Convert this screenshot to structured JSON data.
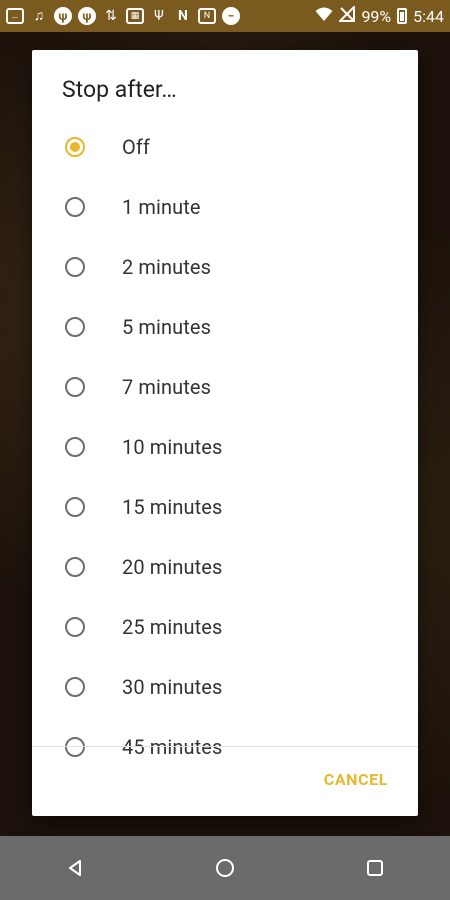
{
  "status_bar": {
    "battery": "99%",
    "time": "5:44",
    "icons": [
      "message-icon",
      "music-icon",
      "tuning-fork-icon",
      "tuning-fork-icon",
      "transfer-icon",
      "photo-icon",
      "usb-icon",
      "n-icon",
      "nfc-icon",
      "do-not-disturb-icon",
      "wifi-icon",
      "no-signal-icon",
      "battery-icon"
    ]
  },
  "dialog": {
    "title": "Stop after…",
    "options": [
      {
        "label": "Off",
        "checked": true
      },
      {
        "label": "1 minute",
        "checked": false
      },
      {
        "label": "2 minutes",
        "checked": false
      },
      {
        "label": "5 minutes",
        "checked": false
      },
      {
        "label": "7 minutes",
        "checked": false
      },
      {
        "label": "10 minutes",
        "checked": false
      },
      {
        "label": "15 minutes",
        "checked": false
      },
      {
        "label": "20 minutes",
        "checked": false
      },
      {
        "label": "25 minutes",
        "checked": false
      },
      {
        "label": "30 minutes",
        "checked": false
      },
      {
        "label": "45 minutes",
        "checked": false
      }
    ],
    "cancel_label": "CANCEL"
  },
  "colors": {
    "accent": "#e6b82a",
    "status_bar": "#7a5a1e",
    "nav_bar": "#6b6b6b"
  }
}
